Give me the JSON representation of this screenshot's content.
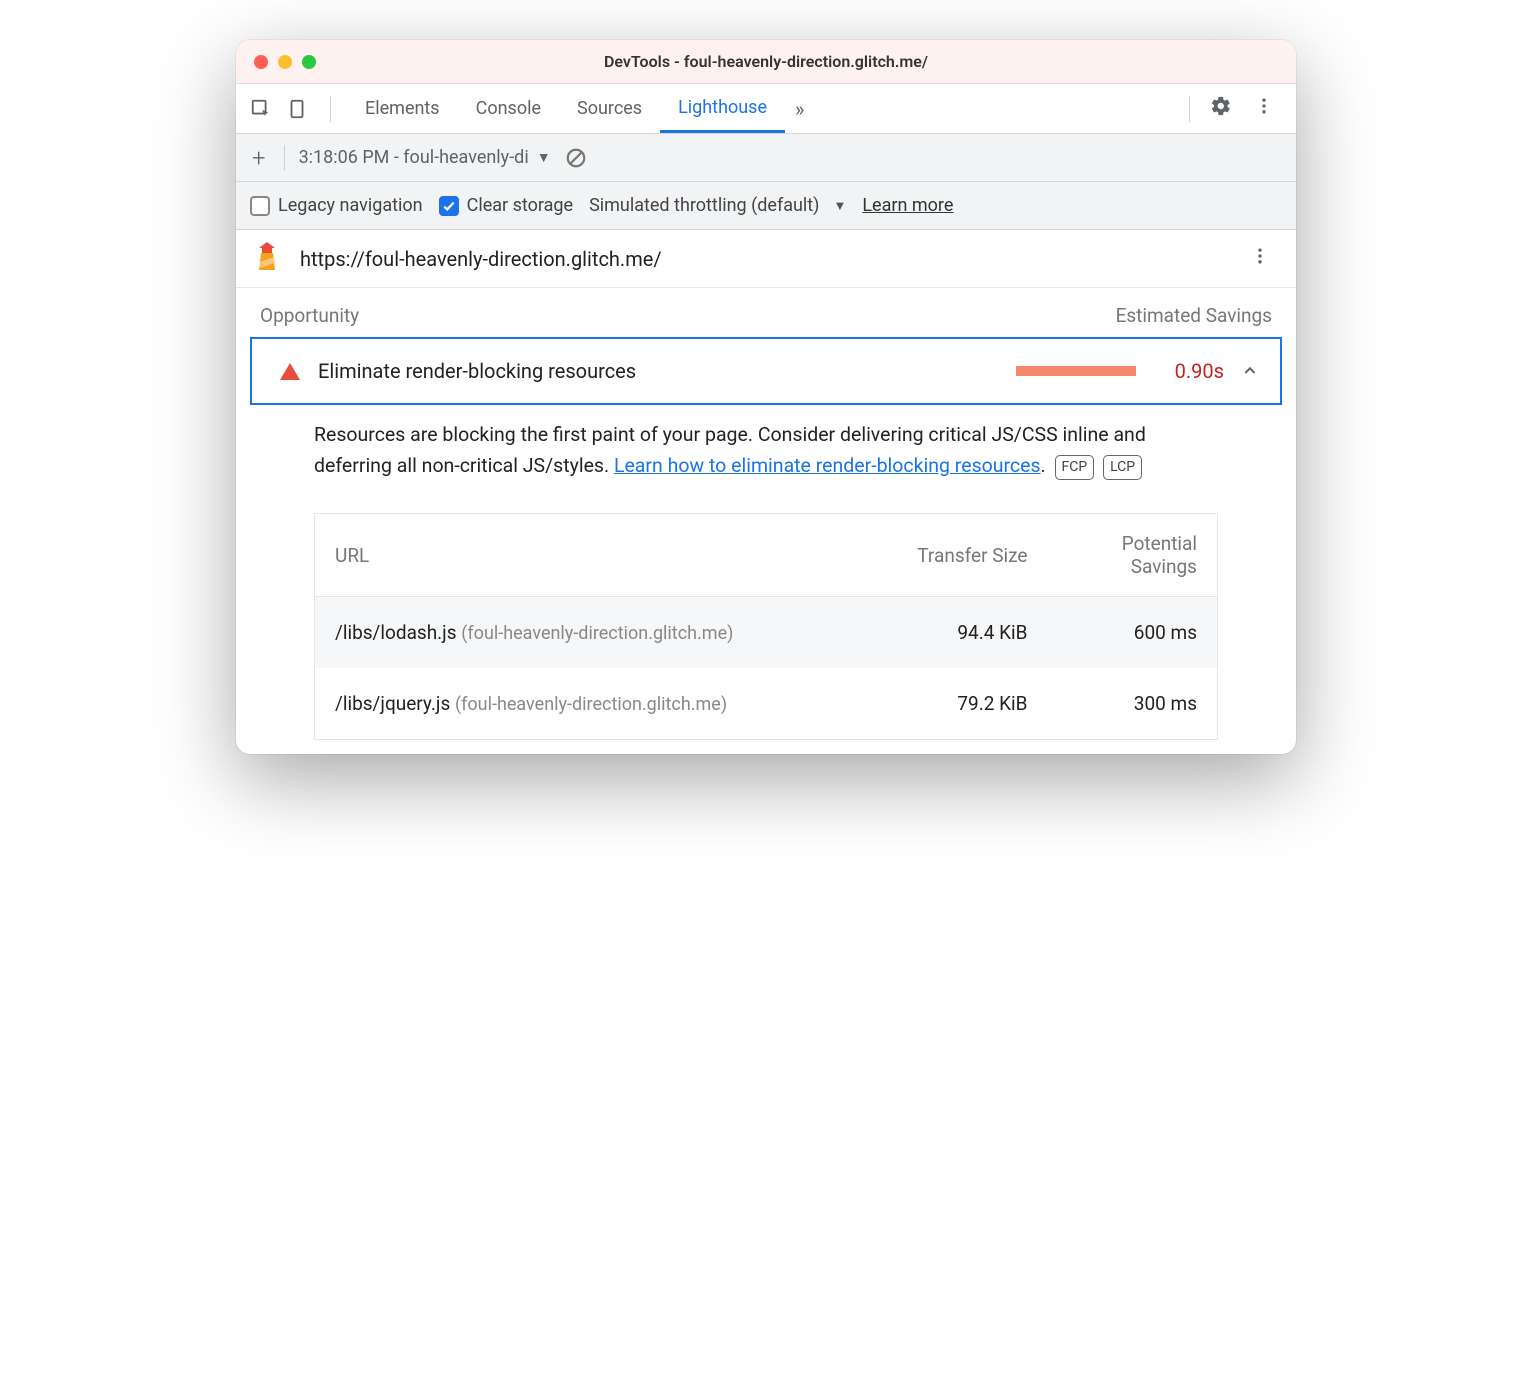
{
  "window": {
    "title": "DevTools - foul-heavenly-direction.glitch.me/"
  },
  "tabs": {
    "items": [
      "Elements",
      "Console",
      "Sources",
      "Lighthouse"
    ],
    "active": "Lighthouse"
  },
  "toolbar2": {
    "run_label": "3:18:06 PM - foul-heavenly-di"
  },
  "toolbar3": {
    "legacy_label": "Legacy navigation",
    "legacy_checked": false,
    "clear_label": "Clear storage",
    "clear_checked": true,
    "throttle_label": "Simulated throttling (default)",
    "learn_more": "Learn more"
  },
  "url_row": {
    "url": "https://foul-heavenly-direction.glitch.me/"
  },
  "headers": {
    "left": "Opportunity",
    "right": "Estimated Savings"
  },
  "audit": {
    "title": "Eliminate render-blocking resources",
    "savings": "0.90s",
    "desc_part1": "Resources are blocking the first paint of your page. Consider delivering critical JS/CSS inline and deferring all non-critical JS/styles. ",
    "desc_link": "Learn how to eliminate render-blocking resources",
    "desc_part2": ".",
    "badges": [
      "FCP",
      "LCP"
    ]
  },
  "table": {
    "cols": {
      "url": "URL",
      "size": "Transfer Size",
      "savings": "Potential Savings"
    },
    "rows": [
      {
        "path": "/libs/lodash.js",
        "host": "(foul-heavenly-direction.glitch.me)",
        "size": "94.4 KiB",
        "savings": "600 ms"
      },
      {
        "path": "/libs/jquery.js",
        "host": "(foul-heavenly-direction.glitch.me)",
        "size": "79.2 KiB",
        "savings": "300 ms"
      }
    ]
  }
}
